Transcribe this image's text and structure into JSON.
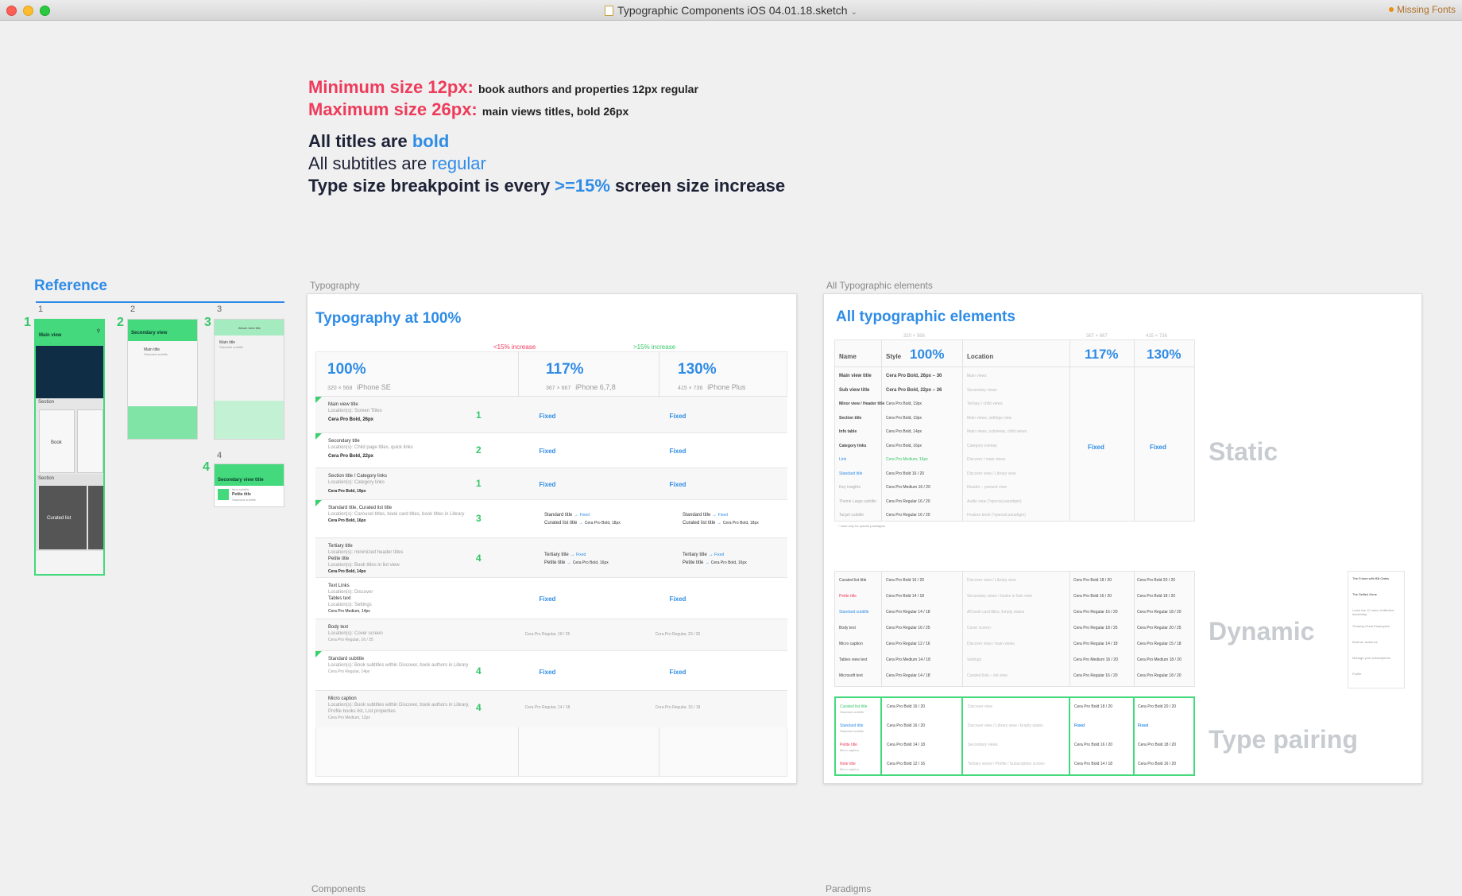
{
  "window": {
    "title": "Typographic Components iOS 04.01.18.sketch",
    "warning": "Missing Fonts",
    "colors": {
      "close": "#fc5f57",
      "minimize": "#fdbb2e",
      "zoom": "#2ac940"
    }
  },
  "headline": {
    "min_label": "Minimum size 12px:",
    "min_note": "book authors and properties 12px regular",
    "max_label": "Maximum size 26px:",
    "max_note": "main views titles, bold 26px",
    "titles_prefix": "All titles are ",
    "titles_accent": "bold",
    "subtitles_prefix": "All subtitles are ",
    "subtitles_accent": "regular",
    "breakpoint_prefix": "Type size breakpoint is every ",
    "breakpoint_accent": ">=15%",
    "breakpoint_suffix": " screen size increase"
  },
  "reference": {
    "title": "Reference",
    "col_numbers": [
      "1",
      "2",
      "3",
      "4"
    ],
    "phone_numbers": [
      "1",
      "2",
      "3",
      "4"
    ],
    "phone1": {
      "header": "Main view",
      "section_a": "Section",
      "book": "Book",
      "section_b": "Section",
      "curated": "Curated list"
    },
    "phone2": {
      "header": "Secondary view",
      "line1": "Main title",
      "line2": "Standard subtitle"
    },
    "phone3": {
      "header": "Album view title",
      "line1": "Main title",
      "line2": "Standard subtitle"
    },
    "phone4": {
      "header": "Secondary view title",
      "line1": "Item subtitle",
      "line2": "Petite title",
      "line3": "Standard subtitle"
    }
  },
  "labels": {
    "typography": "Typography",
    "all_elements": "All Typographic elements",
    "components": "Components",
    "paradigms": "Paradigms"
  },
  "typography": {
    "title": "Typography at 100%",
    "inc_neg": "<15% increase",
    "inc_pos": ">15% increase",
    "cols": [
      {
        "pct": "100%",
        "res": "320 × 568",
        "device": "iPhone SE"
      },
      {
        "pct": "117%",
        "res": "367 × 667",
        "device": "iPhone 6,7,8"
      },
      {
        "pct": "130%",
        "res": "415 × 736",
        "device": "iPhone Plus"
      }
    ],
    "rows": [
      {
        "name": "Main view title",
        "loc": "Location(s): Screen Titles",
        "font": "Cera Pro Bold, 26px",
        "num": "1",
        "c2": "Fixed",
        "c3": "Fixed"
      },
      {
        "name": "Secondary title",
        "loc": "Location(s): Child page titles, quick links",
        "font": "Cera Pro Bold, 22px",
        "num": "2",
        "c2": "Fixed",
        "c3": "Fixed"
      },
      {
        "name": "Section title / Category links",
        "loc": "Location(s): Category links",
        "font": "Cera Pro Bold, 19px",
        "num": "1",
        "c2": "Fixed",
        "c3": "Fixed"
      },
      {
        "name": "Standard title, Curated list title",
        "loc": "Location(s): Carousel titles, book card titles, book titles in Library",
        "font": "Cera Pro Bold, 16px",
        "num": "3",
        "p1": "Standard title",
        "p2": "Curated list title",
        "pv1": "Fixed",
        "pv2": "Cera Pro Bold, 18px"
      },
      {
        "name": "Tertiary title",
        "loc": "Location(s): minimized header titles",
        "name2": "Petite title",
        "loc2": "Location(s): Book titles in list view",
        "font": "Cera Pro Bold, 14px",
        "num": "4",
        "p1": "Tertiary title",
        "p2": "Petite title",
        "pv1": "Fixed",
        "pv2": "Cera Pro Bold, 16px"
      },
      {
        "name": "Text Links",
        "loc": "Location(s): Discover",
        "name2": "Tables text",
        "loc2": "Location(s): Settings",
        "font": "Cera Pro Medium, 14px",
        "num": "",
        "c2": "Fixed",
        "c3": "Fixed"
      },
      {
        "name": "Body text",
        "loc": "Location(s): Cover screen",
        "font": "Cera Pro Regular, 16 / 25",
        "num": "",
        "c2": "Cera Pro Regular, 18 / 25",
        "c3": "Cera Pro Regular, 20 / 25",
        "grey": true
      },
      {
        "name": "Standard subtitle",
        "loc": "Location(s): Book subtitles within Discover, book authors in Library",
        "font": "Cera Pro Regular, 14px",
        "num": "4",
        "c2": "Fixed",
        "c3": "Fixed"
      },
      {
        "name": "Micro caption",
        "loc": "Location(s): Book subtitles within Discover, book authors in Library, Profile books list, List properties",
        "font": "Cera Pro Medium, 12px",
        "num": "4",
        "c2": "Cera Pro Regular, 14 / 18",
        "c3": "Cera Pro Regular, 15 / 18",
        "grey": true
      }
    ]
  },
  "all_elements": {
    "title": "All typographic elements",
    "hdr_name": "Name",
    "hdr_style": "Style",
    "hdr_100": "100%",
    "hdr_location": "Location",
    "hdr_117": "117%",
    "hdr_130": "130%",
    "res_100": "320 × 568",
    "res_117": "367 × 667",
    "res_130": "415 × 736",
    "static_rows": [
      {
        "n": "Main view title",
        "s": "Cera Pro Bold, 26px – 30",
        "l": "Main views"
      },
      {
        "n": "Sub view title",
        "s": "Cera Pro Bold, 22px – 26",
        "l": "Secondary views"
      },
      {
        "n": "Minor view / Header title",
        "s": "Cera Pro Bold, 19px",
        "l": "Tertiary / child views"
      },
      {
        "n": "Section title",
        "s": "Cera Pro Bold, 19px",
        "l": "Main views, settings view"
      },
      {
        "n": "Info table",
        "s": "Cera Pro Bold, 14px",
        "l": "Main views, subviews, child views"
      },
      {
        "n": "Category links",
        "s": "Cera Pro Bold, 16px",
        "l": "Category overlay"
      },
      {
        "n": "Link",
        "s": "Cera Pro Medium, 16px",
        "l": "Discover / main views"
      },
      {
        "n": "Standard title",
        "s": "Cera Pro Bold 16 / 20",
        "l": "Discover view / Library view"
      },
      {
        "n": "Key insights",
        "s": "Cera Pro Medium 16 / 20",
        "l": "Reader – present view"
      },
      {
        "n": "Theme Large subtitle",
        "s": "Cera Pro Regular 16 / 20",
        "l": "Audio view (*special paradigm)"
      },
      {
        "n": "Target subtitle",
        "s": "Cera Pro Regular 16 / 20",
        "l": "Feature book (*special paradigm)"
      }
    ],
    "static_note": "* used only for special paradigms",
    "static_fixed_117": "Fixed",
    "static_fixed_130": "Fixed",
    "dynamic_rows": [
      {
        "n": "Curated list title",
        "s": "Cera Pro Bold 16 / 20",
        "l": "Discover view / Library view",
        "a": "Cera Pro Bold 18 / 20",
        "b": "Cera Pro Bold 20 / 20"
      },
      {
        "n": "Petite title",
        "s": "Cera Pro Bold 14 / 18",
        "l": "Secondary views / books in lists view",
        "a": "Cera Pro Bold 16 / 20",
        "b": "Cera Pro Bold 18 / 20"
      },
      {
        "n": "Standard subtitle",
        "s": "Cera Pro Regular 14 / 18",
        "l": "All book card titles, Empty states",
        "a": "Cera Pro Regular 16 / 20",
        "b": "Cera Pro Regular 18 / 20"
      },
      {
        "n": "Body text",
        "s": "Cera Pro Regular 16 / 25",
        "l": "Cover screen",
        "a": "Cera Pro Regular 18 / 25",
        "b": "Cera Pro Regular 20 / 25"
      },
      {
        "n": "Micro caption",
        "s": "Cera Pro Regular 12 / 16",
        "l": "Discover view / main views",
        "a": "Cera Pro Regular 14 / 18",
        "b": "Cera Pro Regular 15 / 18"
      },
      {
        "n": "Tables view text",
        "s": "Cera Pro Medium 14 / 18",
        "l": "Settings",
        "a": "Cera Pro Medium 16 / 20",
        "b": "Cera Pro Medium 18 / 20"
      },
      {
        "n": "Microsoft text",
        "s": "Cera Pro Regular 14 / 18",
        "l": "Curated lists – list view",
        "a": "Cera Pro Regular 16 / 20",
        "b": "Cera Pro Regular 18 / 20"
      }
    ],
    "pairing_rows": [
      {
        "n": "Curated list title",
        "n2": "Standard subtitle",
        "s": "Cera Pro Bold 16 / 20",
        "l": "Discover view",
        "a": "Cera Pro Bold 18 / 20",
        "b": "Cera Pro Bold 20 / 20"
      },
      {
        "n": "Standard title",
        "n2": "Standard subtitle",
        "s": "Cera Pro Bold 16 / 20",
        "l": "Discover view / Library view / Empty states",
        "a": "Fixed",
        "b": "Fixed"
      },
      {
        "n": "Petite title",
        "n2": "Micro caption",
        "s": "Cera Pro Bold 14 / 18",
        "l": "Secondary views",
        "a": "Cera Pro Bold 16 / 20",
        "b": "Cera Pro Bold 18 / 20"
      },
      {
        "n": "Note title",
        "n2": "Micro caption",
        "s": "Cera Pro Bold 12 / 16",
        "l": "Tertiary views / Profile / Subscription screen",
        "a": "Cera Pro Bold 14 / 18",
        "b": "Cera Pro Bold 16 / 20"
      }
    ],
    "side_labels": {
      "static": "Static",
      "dynamic": "Dynamic",
      "pairing": "Type pairing"
    },
    "preview": [
      "The Future with Bill Gates",
      "The Selfish Gene",
      "Learn the 12 rules of effective leadership",
      "Growing Great Employees",
      "Build an audience",
      "Manage your subscriptions",
      "Profile"
    ]
  }
}
